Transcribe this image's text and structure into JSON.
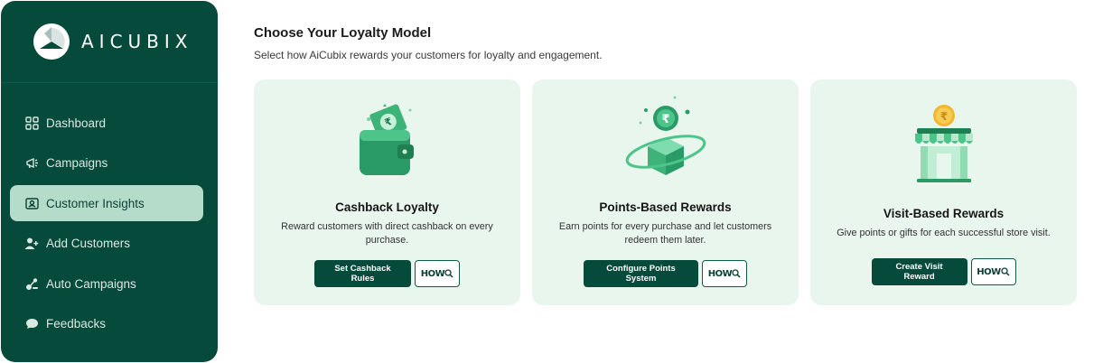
{
  "brand": {
    "name": "AICUBIX"
  },
  "sidebar": {
    "items": [
      {
        "label": "Dashboard",
        "icon": "grid-icon",
        "active": false
      },
      {
        "label": "Campaigns",
        "icon": "megaphone-icon",
        "active": false
      },
      {
        "label": "Customer Insights",
        "icon": "id-card-icon",
        "active": true
      },
      {
        "label": "Add Customers",
        "icon": "add-user-icon",
        "active": false
      },
      {
        "label": "Auto Campaigns",
        "icon": "automation-icon",
        "active": false
      },
      {
        "label": "Feedbacks",
        "icon": "chat-bubble-icon",
        "active": false
      }
    ]
  },
  "main": {
    "title": "Choose Your Loyalty Model",
    "subtitle": "Select how AiCubix rewards your customers for loyalty and engagement.",
    "cards": [
      {
        "title": "Cashback Loyalty",
        "description": "Reward customers with direct cashback on every purchase.",
        "primary_label": "Set Cashback Rules",
        "how_label": "HOW",
        "illustration": "wallet-icon"
      },
      {
        "title": "Points-Based Rewards",
        "description": "Earn points for every purchase and let customers redeem them later.",
        "primary_label": "Configure Points System",
        "how_label": "HOW",
        "illustration": "coin-box-icon"
      },
      {
        "title": "Visit-Based Rewards",
        "description": "Give points or gifts for each successful store visit.",
        "primary_label": "Create Visit Reward",
        "how_label": "HOW",
        "illustration": "storefront-icon"
      }
    ]
  },
  "colors": {
    "sidebar_bg": "#064a3b",
    "active_item_bg": "#b5dccb",
    "card_bg": "#e9f6ee",
    "accent": "#2fa874"
  }
}
